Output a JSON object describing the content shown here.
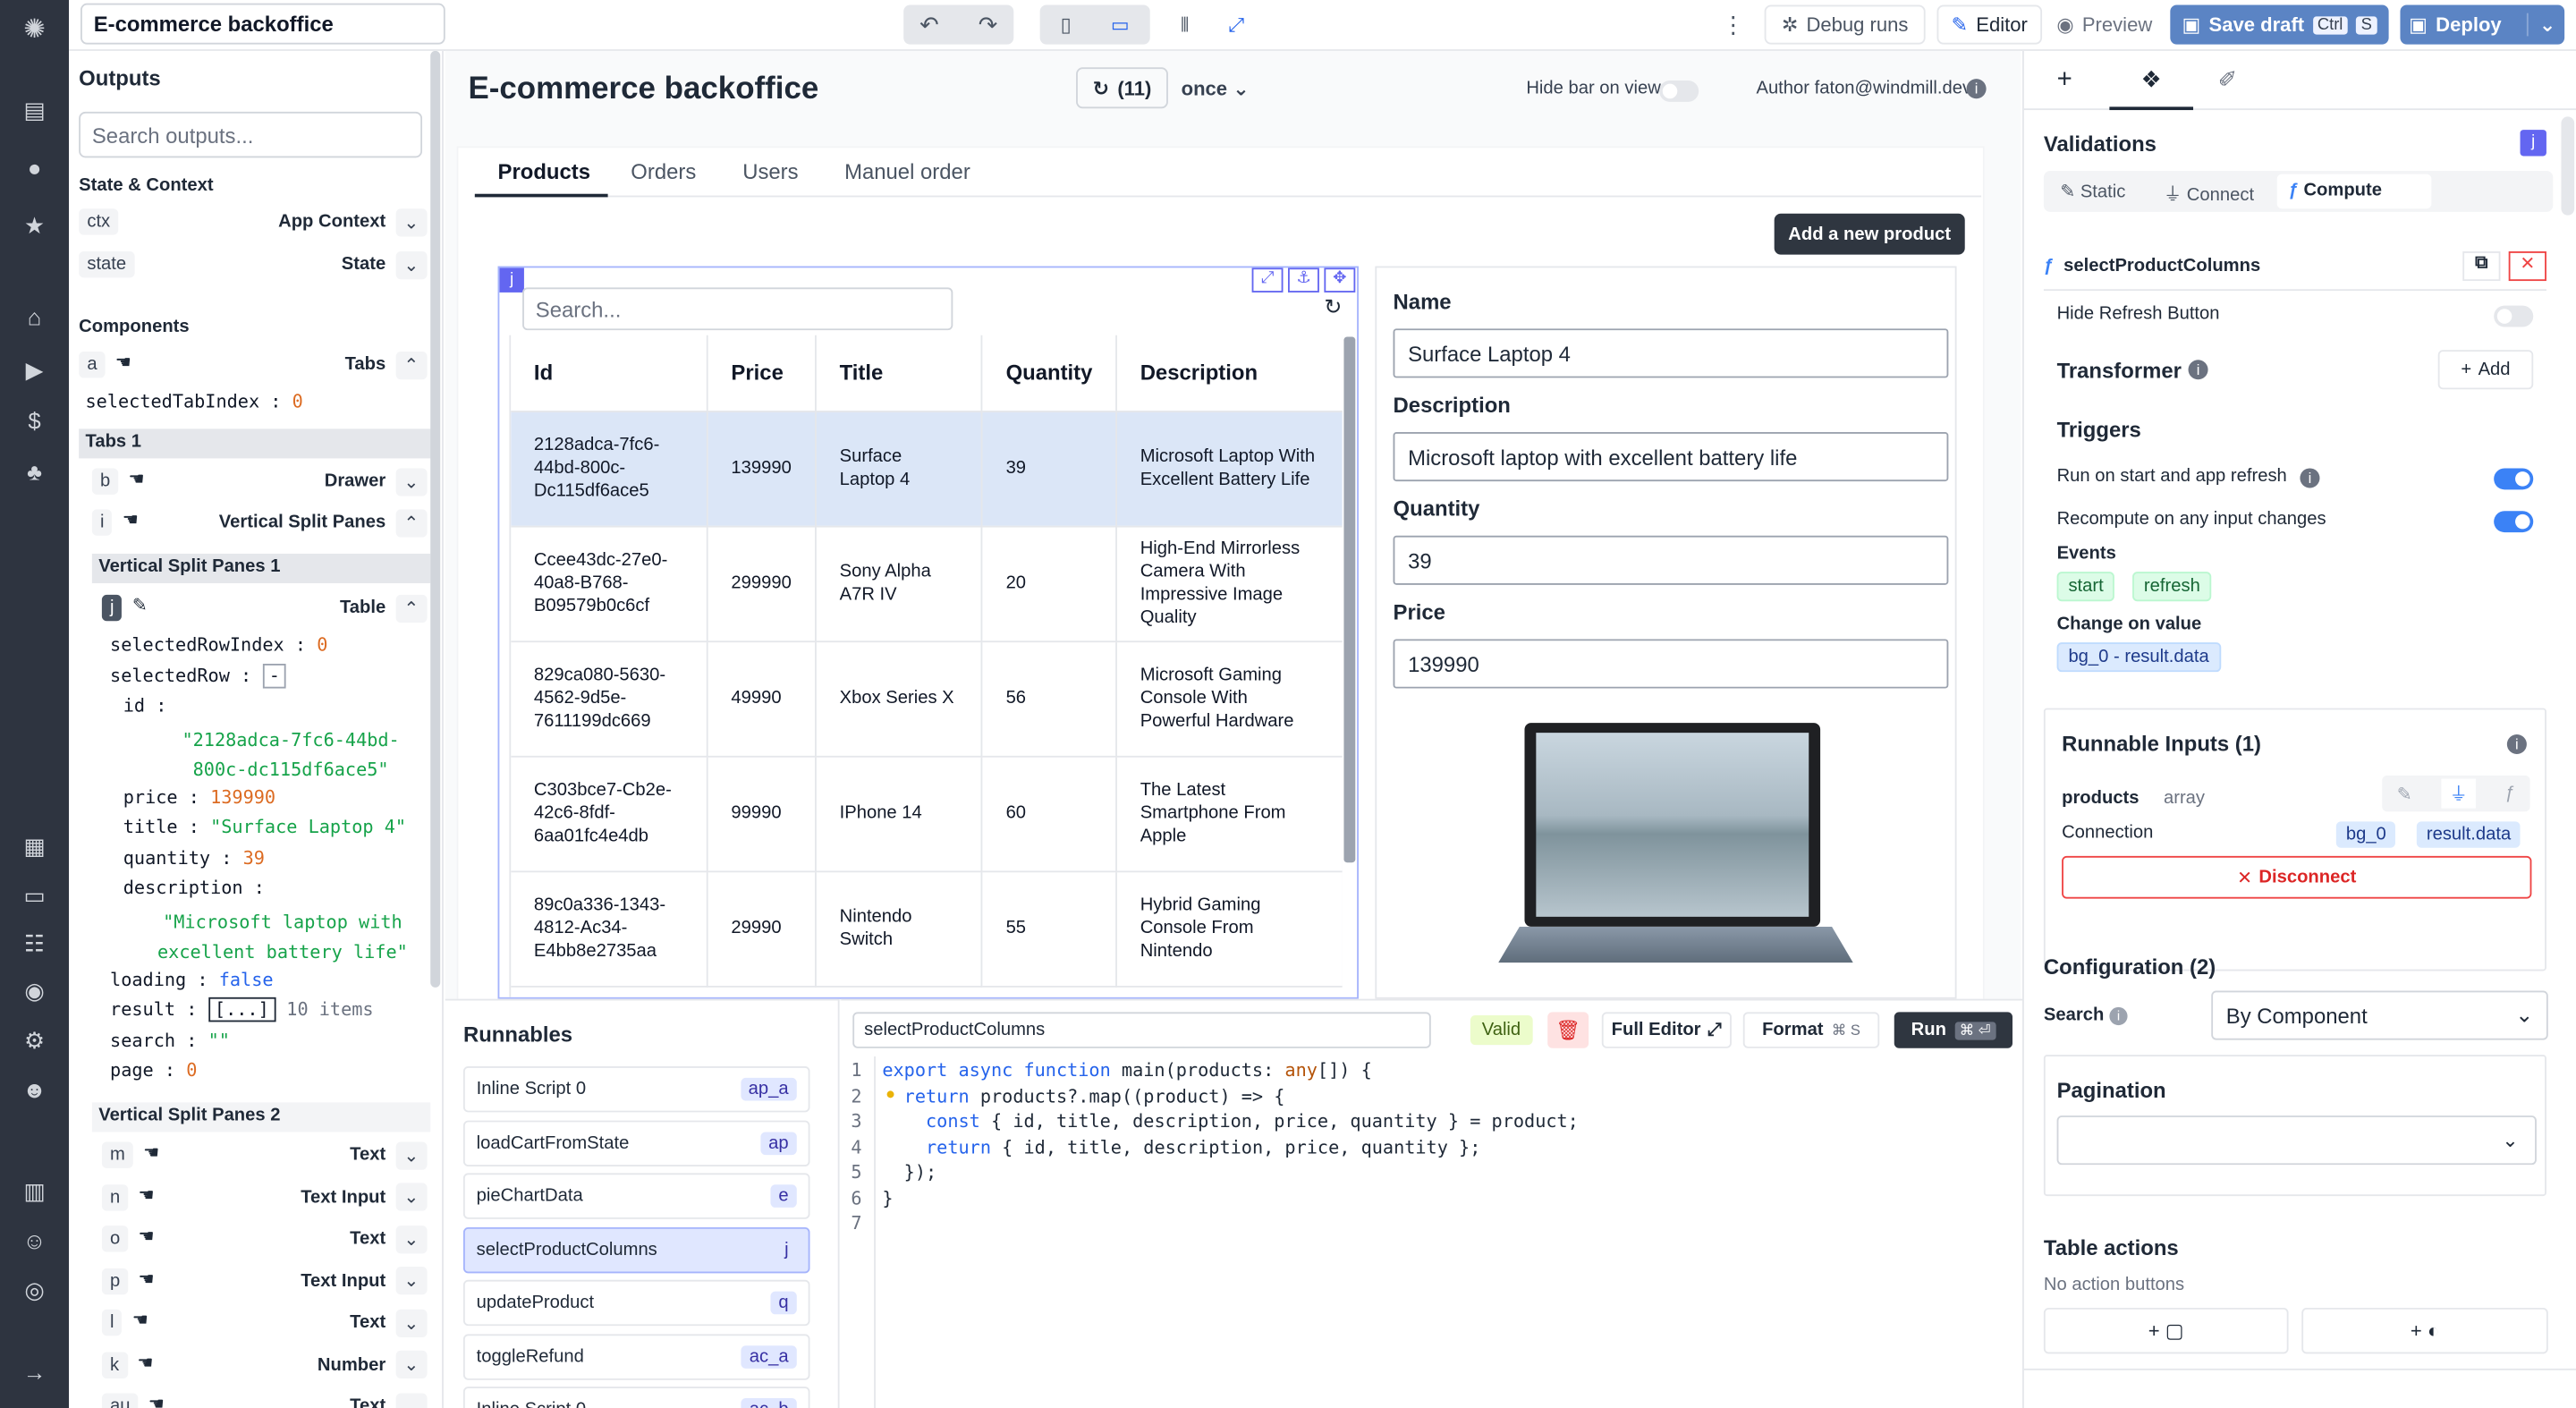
{
  "app": {
    "title": "E-commerce backoffice",
    "canvas_title": "E-commerce backoffice"
  },
  "topbar": {
    "debug_runs": "Debug runs",
    "editor": "Editor",
    "preview": "Preview",
    "save_draft": "Save draft",
    "save_kbd": "Ctrl",
    "save_kbd2": "S",
    "deploy": "Deploy"
  },
  "canvas_header": {
    "refresh_count": "(11)",
    "refresh_mode": "once",
    "hide_bar": "Hide bar on view",
    "author": "Author faton@windmill.dev"
  },
  "tabs": [
    "Products",
    "Orders",
    "Users",
    "Manuel order"
  ],
  "add_product": "Add a new product",
  "table": {
    "search_placeholder": "Search...",
    "columns": [
      "Id",
      "Price",
      "Title",
      "Quantity",
      "Description"
    ],
    "rows": [
      [
        "2128adca-7fc6-44bd-800c-Dc115df6ace5",
        "139990",
        "Surface Laptop 4",
        "39",
        "Microsoft Laptop With Excellent Battery Life"
      ],
      [
        "Ccee43dc-27e0-40a8-B768-B09579b0c6cf",
        "299990",
        "Sony Alpha A7R IV",
        "20",
        "High-End Mirrorless Camera With Impressive Image Quality"
      ],
      [
        "829ca080-5630-4562-9d5e-7611199dc669",
        "49990",
        "Xbox Series X",
        "56",
        "Microsoft Gaming Console With Powerful Hardware"
      ],
      [
        "C303bce7-Cb2e-42c6-8fdf-6aa01fc4e4db",
        "99990",
        "IPhone 14",
        "60",
        "The Latest Smartphone From Apple"
      ],
      [
        "89c0a336-1343-4812-Ac34-E4bb8e2735aa",
        "29990",
        "Nintendo Switch",
        "55",
        "Hybrid Gaming Console From Nintendo"
      ]
    ]
  },
  "form": {
    "name_label": "Name",
    "name_value": "Surface Laptop 4",
    "desc_label": "Description",
    "desc_value": "Microsoft laptop with excellent battery life",
    "qty_label": "Quantity",
    "qty_value": "39",
    "price_label": "Price",
    "price_value": "139990"
  },
  "outputs": {
    "title": "Outputs",
    "search_placeholder": "Search outputs...",
    "state_context": "State & Context",
    "ctx": "ctx",
    "app_context": "App Context",
    "state": "state",
    "state_label": "State",
    "components": "Components",
    "a": "a",
    "a_type": "Tabs",
    "selectedTabIndex_key": "selectedTabIndex",
    "selectedTabIndex_val": "0",
    "tabs1": "Tabs 1",
    "b": "b",
    "b_type": "Drawer",
    "i": "i",
    "i_type": "Vertical Split Panes",
    "vsp1": "Vertical Split Panes 1",
    "j": "j",
    "j_type": "Table",
    "selectedRowIndex_key": "selectedRowIndex",
    "selectedRowIndex_val": "0",
    "selectedRow_key": "selectedRow",
    "selectedRow_val": "-",
    "id_key": "id",
    "id_val": "\"2128adca-7fc6-44bd-800c-dc115df6ace5\"",
    "price_key": "price",
    "price_val": "139990",
    "title_key": "title",
    "title_val": "\"Surface Laptop 4\"",
    "quantity_key": "quantity",
    "quantity_val": "39",
    "description_key": "description",
    "description_val": "\"Microsoft laptop with excellent battery life\"",
    "loading_key": "loading",
    "loading_val": "false",
    "result_key": "result",
    "result_val": "[...]",
    "result_count": "10 items",
    "search_key": "search",
    "search_val": "\"\"",
    "page_key": "page",
    "page_val": "0",
    "vsp2": "Vertical Split Panes 2",
    "comps": [
      {
        "id": "m",
        "type": "Text"
      },
      {
        "id": "n",
        "type": "Text Input"
      },
      {
        "id": "o",
        "type": "Text"
      },
      {
        "id": "p",
        "type": "Text Input"
      },
      {
        "id": "l",
        "type": "Text"
      },
      {
        "id": "k",
        "type": "Number"
      },
      {
        "id": "au",
        "type": "Text"
      }
    ]
  },
  "runnables": {
    "title": "Runnables",
    "items": [
      {
        "label": "Inline Script 0",
        "badge": "ap_a"
      },
      {
        "label": "loadCartFromState",
        "badge": "ap"
      },
      {
        "label": "pieChartData",
        "badge": "e"
      },
      {
        "label": "selectProductColumns",
        "badge": "j"
      },
      {
        "label": "updateProduct",
        "badge": "q"
      },
      {
        "label": "toggleRefund",
        "badge": "ac_a"
      },
      {
        "label": "Inline Script 0",
        "badge": "ac_b"
      }
    ]
  },
  "editor": {
    "name": "selectProductColumns",
    "valid": "Valid",
    "full_editor": "Full Editor",
    "format": "Format",
    "format_kbd": "⌘ S",
    "run": "Run",
    "lines": [
      "1",
      "2",
      "3",
      "4",
      "5",
      "6",
      "7"
    ]
  },
  "right": {
    "validations": "Validations",
    "j_badge": "j",
    "tab_static": "Static",
    "tab_connect": "Connect",
    "tab_compute": "Compute",
    "fn_name": "selectProductColumns",
    "hide_refresh": "Hide Refresh Button",
    "transformer": "Transformer",
    "add": "Add",
    "triggers": "Triggers",
    "run_on_start": "Run on start and app refresh",
    "recompute": "Recompute on any input changes",
    "events": "Events",
    "ev_start": "start",
    "ev_refresh": "refresh",
    "change_on_value": "Change on value",
    "change_pill": "bg_0 - result.data",
    "runnable_inputs": "Runnable Inputs (1)",
    "products": "products",
    "products_type": "array",
    "connection": "Connection",
    "conn_a": "bg_0",
    "conn_b": "result.data",
    "disconnect": "Disconnect",
    "configuration": "Configuration (2)",
    "search_label": "Search",
    "search_value": "By Component",
    "pagination": "Pagination",
    "table_actions": "Table actions",
    "no_actions": "No action buttons"
  }
}
